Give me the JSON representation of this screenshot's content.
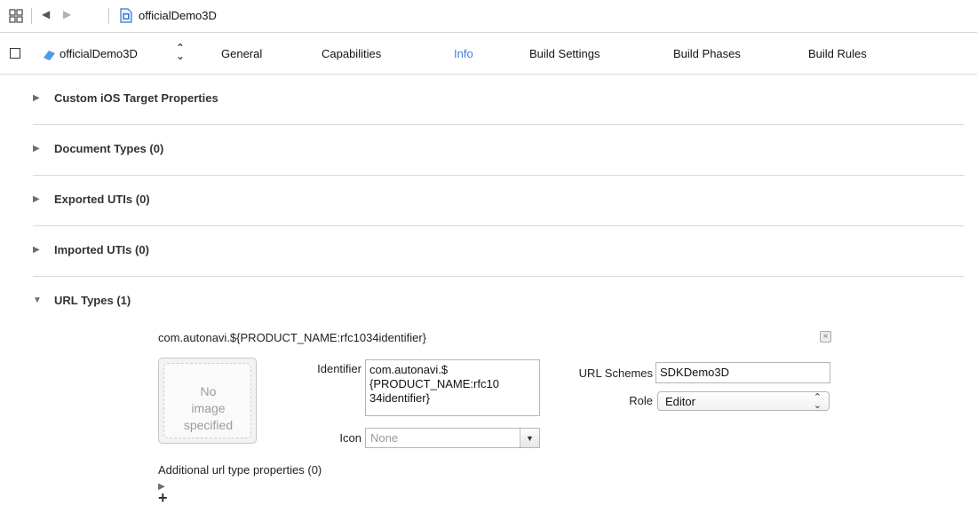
{
  "jumpbar": {
    "back_glyph": "◀",
    "forward_glyph": "▶",
    "breadcrumb": "officialDemo3D",
    "icons": [
      "related-items-grid-icon",
      "project-file-icon"
    ]
  },
  "tabbar": {
    "target_name": "officialDemo3D",
    "stepper_glyph": "⌃⌄",
    "tabs": [
      {
        "label": "General"
      },
      {
        "label": "Capabilities"
      },
      {
        "label": "Info",
        "active": true
      },
      {
        "label": "Build Settings"
      },
      {
        "label": "Build Phases"
      },
      {
        "label": "Build Rules"
      }
    ],
    "accent_color": "#3c7fd8"
  },
  "sections": [
    {
      "title": "Custom iOS Target Properties",
      "disclosure": "▶"
    },
    {
      "title": "Document Types (0)",
      "disclosure": "▶"
    },
    {
      "title": "Exported UTIs (0)",
      "disclosure": "▶"
    },
    {
      "title": "Imported UTIs (0)",
      "disclosure": "▶"
    }
  ],
  "url_types": {
    "title": "URL Types (1)",
    "disclosure": "▼",
    "entry": {
      "title": "com.autonavi.${PRODUCT_NAME:rfc1034identifier}",
      "remove_glyph": "×",
      "image_well_text": "No\nimage\nspecified",
      "identifier_label": "Identifier",
      "identifier_value": "com.autonavi.$\n{PRODUCT_NAME:rfc10\n34identifier}",
      "icon_label": "Icon",
      "icon_value": "None",
      "icon_dropdown_glyph": "▼",
      "url_schemes_label": "URL Schemes",
      "url_schemes_value": "SDKDemo3D",
      "role_label": "Role",
      "role_value": "Editor",
      "role_arrows": "⌃⌄"
    },
    "additional_label": "Additional url type properties (0)",
    "additional_disclosure": "▶",
    "add_glyph": "+"
  }
}
